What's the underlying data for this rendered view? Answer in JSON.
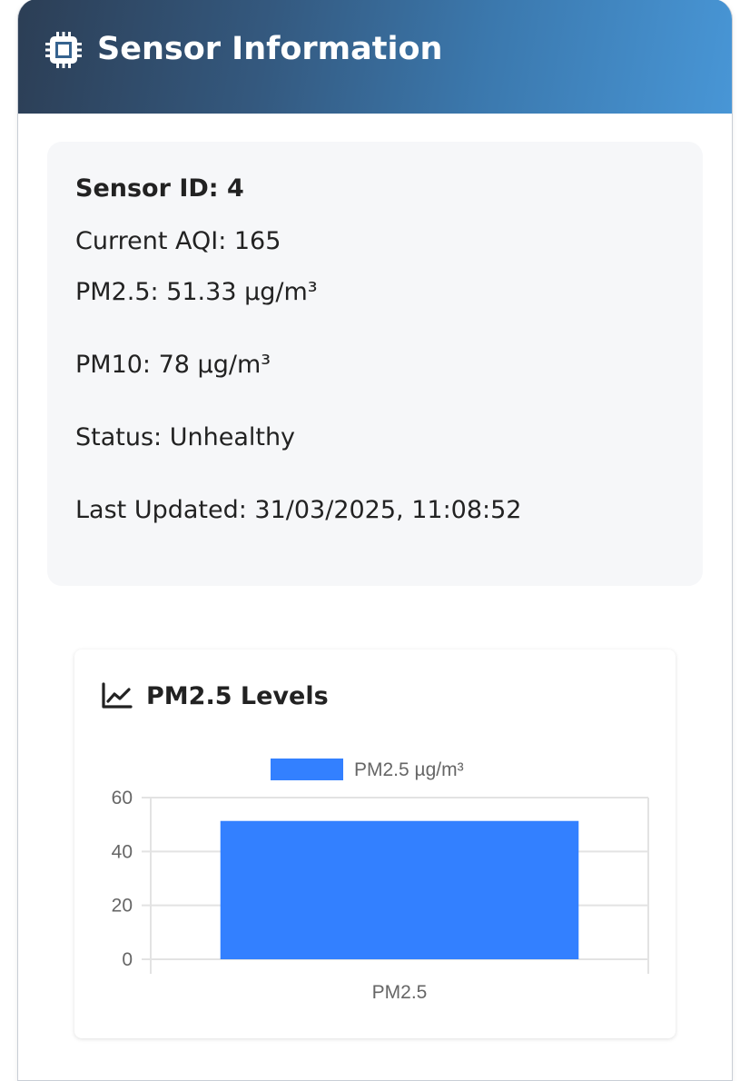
{
  "panel": {
    "title": "Sensor Information",
    "icon": "chip-icon"
  },
  "info": {
    "sensor_id": "Sensor ID: 4",
    "current_aqi": "Current AQI: 165",
    "pm25": "PM2.5: 51.33 µg/m³",
    "pm10": "PM10: 78 µg/m³",
    "status": "Status: Unhealthy",
    "last_updated": "Last Updated: 31/03/2025, 11:08:52"
  },
  "chart_card": {
    "title": "PM2.5 Levels",
    "icon": "line-chart-icon"
  },
  "colors": {
    "bar": "#3380ff",
    "header_start": "#2c3e55",
    "header_end": "#4896d6"
  },
  "chart_data": {
    "type": "bar",
    "categories": [
      "PM2.5"
    ],
    "series": [
      {
        "name": "PM2.5 µg/m³",
        "values": [
          51.33
        ]
      }
    ],
    "ylim": [
      0,
      60
    ],
    "yticks": [
      0,
      20,
      40,
      60
    ],
    "grid": true,
    "legend": "top-center",
    "xlabel": "",
    "ylabel": ""
  }
}
